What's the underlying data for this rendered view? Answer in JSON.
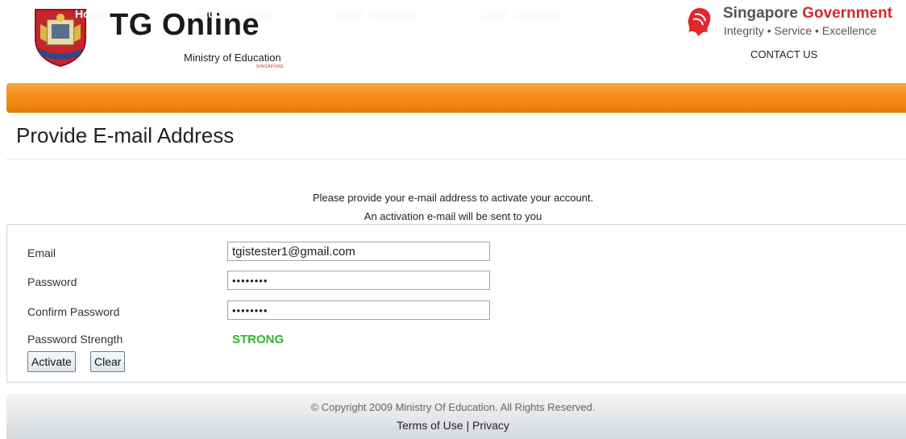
{
  "header": {
    "title": "TG Online",
    "ministry": "Ministry of Education",
    "ministry_sub": "SINGAPORE",
    "gov_name_part1": "Singapore ",
    "gov_name_part2": "Government",
    "gov_tagline": "Integrity • Service • Excellence",
    "contact": "CONTACT US"
  },
  "nav": {
    "items": [
      {
        "label": "Home"
      },
      {
        "label": "Student Login"
      },
      {
        "label": "Grant Schemes"
      },
      {
        "label": "Grant Calendar"
      }
    ]
  },
  "page": {
    "title": "Provide E-mail Address",
    "instruction_line1": "Please provide your e-mail address to activate your account.",
    "instruction_line2": "An activation e-mail will be sent to you"
  },
  "form": {
    "email_label": "Email",
    "email_value": "tgistester1@gmail.com",
    "password_label": "Password",
    "password_value": "••••••••",
    "confirm_label": "Confirm Password",
    "confirm_value": "••••••••",
    "strength_label": "Password Strength",
    "strength_value": "STRONG",
    "activate_label": "Activate",
    "clear_label": "Clear"
  },
  "footer": {
    "copyright": "© Copyright 2009 Ministry Of Education. All Rights Reserved.",
    "terms": "Terms of Use",
    "separator": "|",
    "privacy": "Privacy"
  },
  "colors": {
    "nav_orange": "#f38d17",
    "strength_green": "#2fb52f",
    "gov_red": "#d42b2b"
  }
}
